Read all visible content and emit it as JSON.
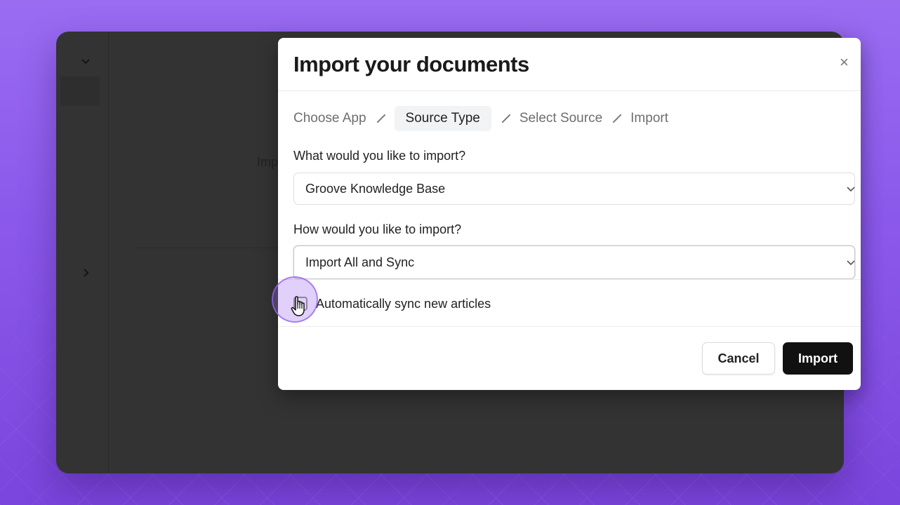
{
  "modal": {
    "title": "Import your documents",
    "close_icon": "×",
    "breadcrumb": [
      {
        "label": "Choose App",
        "active": false
      },
      {
        "label": "Source Type",
        "active": true
      },
      {
        "label": "Select Source",
        "active": false
      },
      {
        "label": "Import",
        "active": false
      }
    ],
    "source_question": "What would you like to import?",
    "source_value": "Groove Knowledge Base",
    "method_question": "How would you like to import?",
    "method_value": "Import All and Sync",
    "sync_checkbox": {
      "label": "Automatically sync new articles",
      "checked": false
    },
    "cancel_label": "Cancel",
    "import_label": "Import"
  },
  "background": {
    "partial_text": "Imp",
    "sidebar_icons": [
      "chevron-down-icon",
      "chevron-right-icon"
    ]
  },
  "colors": {
    "background_purple": "#8a58ea",
    "app_dark": "#333333",
    "primary_button": "#111111",
    "active_crumb_bg": "#f1f3f4",
    "click_highlight": "#a06ef0"
  }
}
